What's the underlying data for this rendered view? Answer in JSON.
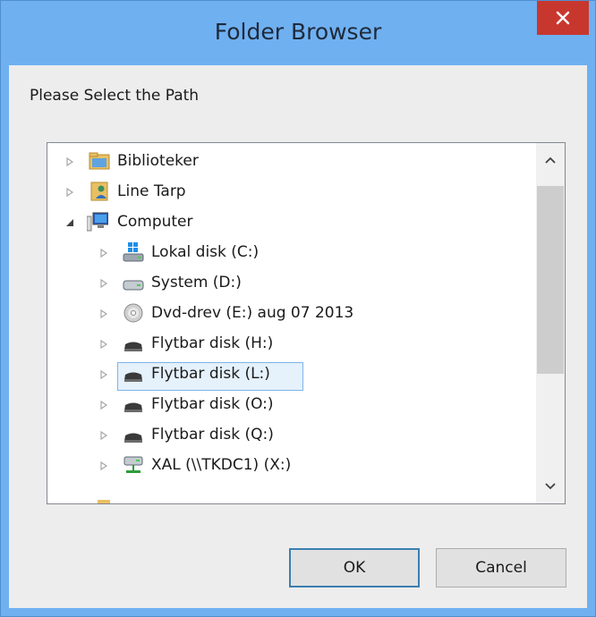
{
  "window": {
    "title": "Folder Browser",
    "close_glyph": "✕"
  },
  "prompt": "Please Select the Path",
  "tree": {
    "items": [
      {
        "label": "Biblioteker",
        "icon": "library-icon",
        "expander": "collapsed",
        "level": 0
      },
      {
        "label": "Line Tarp",
        "icon": "user-folder-icon",
        "expander": "collapsed",
        "level": 0
      },
      {
        "label": "Computer",
        "icon": "computer-icon",
        "expander": "expanded",
        "level": 0
      },
      {
        "label": "Lokal disk (C:)",
        "icon": "windows-drive-icon",
        "expander": "collapsed",
        "level": 1
      },
      {
        "label": "System (D:)",
        "icon": "hard-drive-icon",
        "expander": "collapsed",
        "level": 1
      },
      {
        "label": "Dvd-drev (E:) aug 07 2013",
        "icon": "dvd-drive-icon",
        "expander": "collapsed",
        "level": 1
      },
      {
        "label": "Flytbar disk (H:)",
        "icon": "removable-drive-icon",
        "expander": "collapsed",
        "level": 1
      },
      {
        "label": "Flytbar disk (L:)",
        "icon": "removable-drive-icon",
        "expander": "collapsed",
        "level": 1,
        "selected": true
      },
      {
        "label": "Flytbar disk (O:)",
        "icon": "removable-drive-icon",
        "expander": "collapsed",
        "level": 1
      },
      {
        "label": "Flytbar disk (Q:)",
        "icon": "removable-drive-icon",
        "expander": "collapsed",
        "level": 1
      },
      {
        "label": "XAL (\\\\TKDC1) (X:)",
        "icon": "network-drive-icon",
        "expander": "collapsed",
        "level": 1
      }
    ]
  },
  "buttons": {
    "ok": "OK",
    "cancel": "Cancel"
  },
  "colors": {
    "titlebar": "#6fb0f1",
    "close": "#c8372e",
    "selection_fill": "#e5f1fb",
    "selection_border": "#7eb4ea"
  }
}
